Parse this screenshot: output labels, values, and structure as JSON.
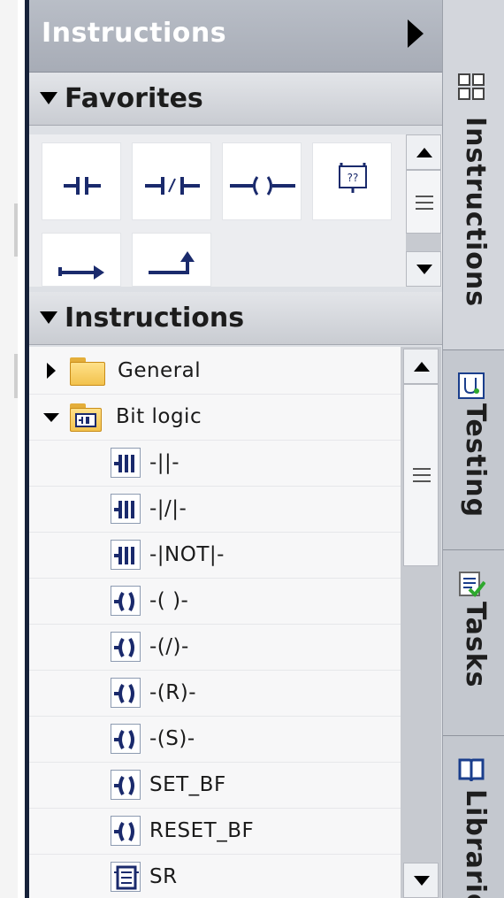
{
  "panel": {
    "title": "Instructions"
  },
  "favorites": {
    "header": "Favorites",
    "items": [
      {
        "icon": "normally-open-contact-icon"
      },
      {
        "icon": "normally-closed-contact-icon"
      },
      {
        "icon": "output-coil-icon"
      },
      {
        "icon": "empty-box-icon",
        "label": "??"
      },
      {
        "icon": "open-branch-icon"
      },
      {
        "icon": "close-branch-icon"
      }
    ]
  },
  "instructions": {
    "header": "Instructions",
    "tree": [
      {
        "label": "General",
        "type": "folder",
        "expanded": false,
        "icon": "folder-icon"
      },
      {
        "label": "Bit logic",
        "type": "folder",
        "expanded": true,
        "icon": "bit-logic-folder-icon"
      },
      {
        "label": "-||-",
        "type": "contact",
        "icon": "contact-icon"
      },
      {
        "label": "-|/|-",
        "type": "contact",
        "icon": "contact-icon"
      },
      {
        "label": "-|NOT|-",
        "type": "contact",
        "icon": "contact-icon"
      },
      {
        "label": "-( )-",
        "type": "coil",
        "icon": "coil-icon"
      },
      {
        "label": "-(/)-",
        "type": "coil",
        "icon": "coil-icon"
      },
      {
        "label": "-(R)-",
        "type": "coil",
        "icon": "coil-icon"
      },
      {
        "label": "-(S)-",
        "type": "coil",
        "icon": "coil-icon"
      },
      {
        "label": "SET_BF",
        "type": "coil",
        "icon": "coil-icon"
      },
      {
        "label": "RESET_BF",
        "type": "coil",
        "icon": "coil-icon"
      },
      {
        "label": "SR",
        "type": "box",
        "icon": "box-icon"
      }
    ]
  },
  "side_tabs": [
    {
      "label": "Instructions",
      "icon": "grid-icon",
      "active": true
    },
    {
      "label": "Testing",
      "icon": "testing-icon",
      "active": false
    },
    {
      "label": "Tasks",
      "icon": "tasks-icon",
      "active": false
    },
    {
      "label": "Libraries",
      "icon": "book-icon",
      "active": false
    }
  ],
  "colors": {
    "header_bg": "#a7acb6",
    "panel_bg": "#dde0e5",
    "folder": "#f2c24d",
    "icon_navy": "#1a2a6c",
    "check_green": "#2ea82e"
  }
}
